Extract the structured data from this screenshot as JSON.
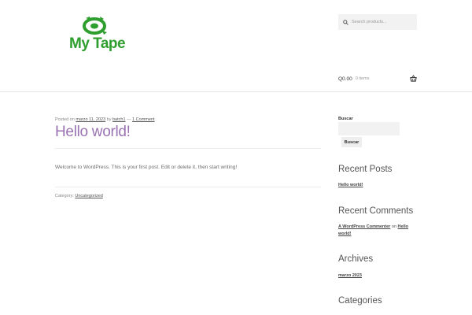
{
  "header": {
    "logo_text": "My Tape",
    "search": {
      "placeholder": "Search products..."
    },
    "cart": {
      "amount": "Q0.00",
      "items": "0 items"
    }
  },
  "post": {
    "meta": {
      "posted_on": "Posted on",
      "date": "marzo 11, 2023",
      "by": "by",
      "author": "batch1",
      "sep": "—",
      "comments": "1 Comment"
    },
    "title": "Hello world!",
    "body": "Welcome to WordPress. This is your first post. Edit or delete it, then start writing!",
    "category_label": "Category:",
    "category": "Uncategorized"
  },
  "sidebar": {
    "search_label": "Buscar",
    "search_button": "Buscar",
    "recent_posts": {
      "title": "Recent Posts",
      "items": [
        "Hello world!"
      ]
    },
    "recent_comments": {
      "title": "Recent Comments",
      "author": "A WordPress Commenter",
      "on": "on",
      "post_part1": "Hello",
      "post_part2": "world!"
    },
    "archives": {
      "title": "Archives",
      "items": [
        "marzo 2023"
      ]
    },
    "categories": {
      "title": "Categories"
    }
  },
  "colors": {
    "brand_green": "#2e9e2e",
    "title_purple": "#9a73b3"
  },
  "icons": {
    "logo": "tape-logo-icon",
    "search": "search-icon",
    "cart": "shopping-basket-icon"
  }
}
